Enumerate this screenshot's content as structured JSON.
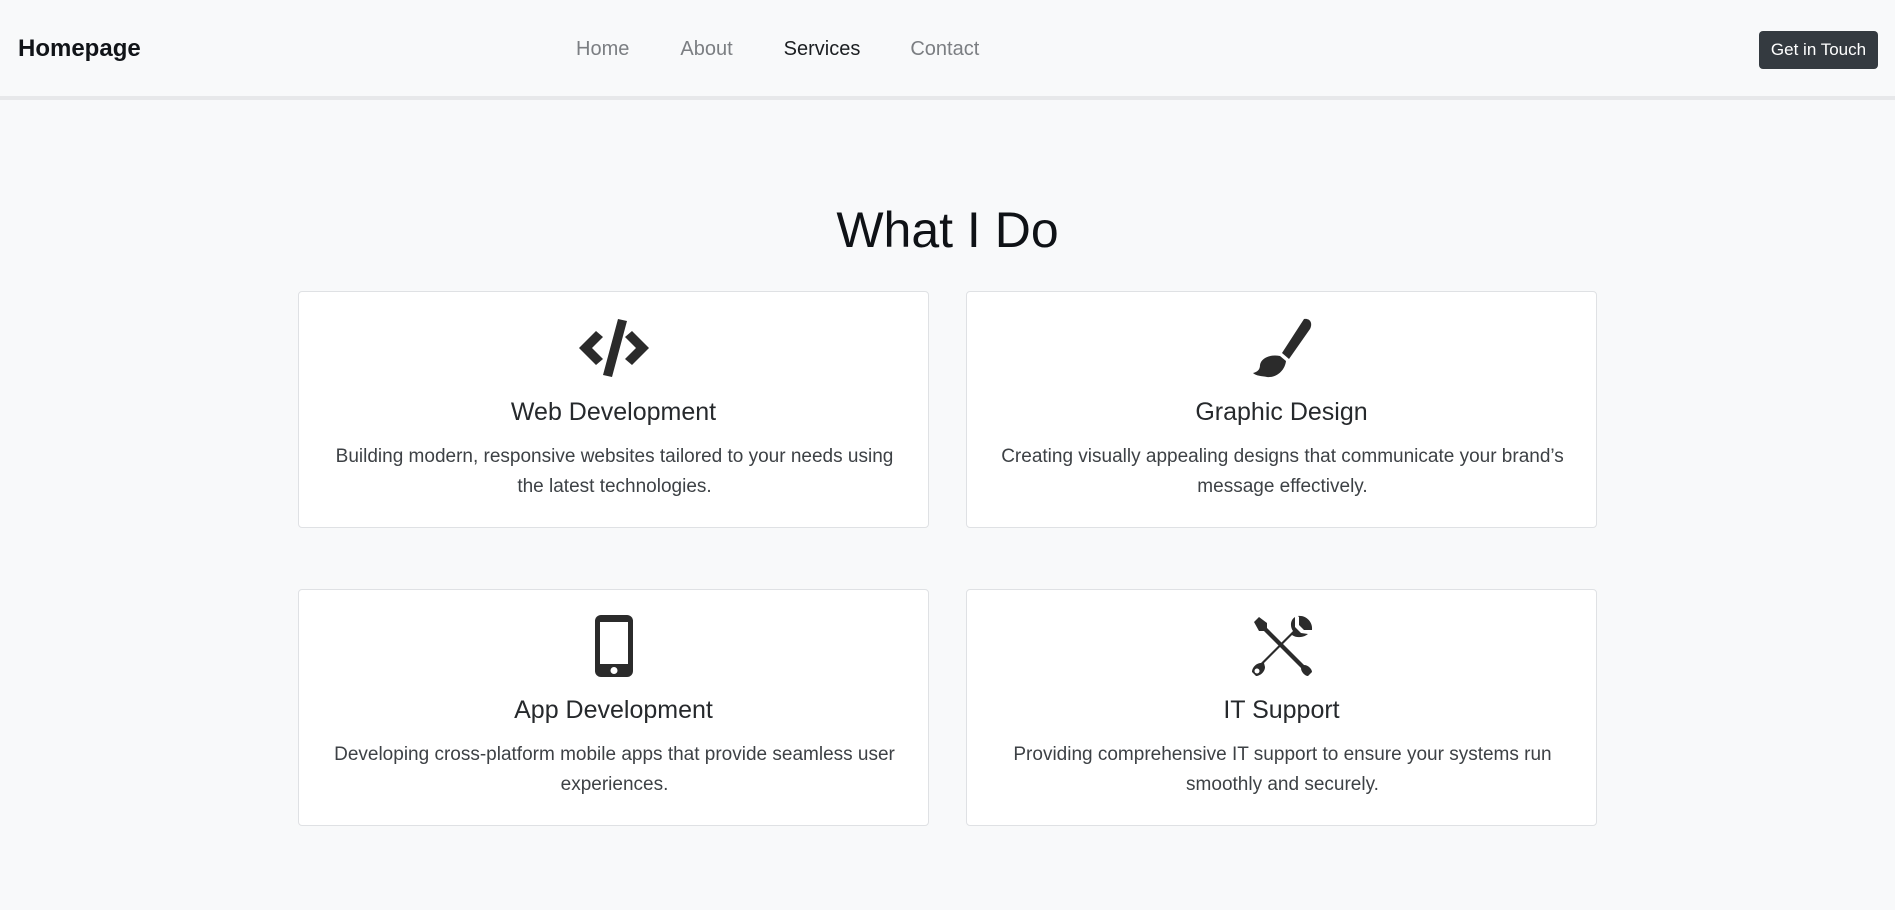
{
  "header": {
    "brand": "Homepage",
    "nav": [
      {
        "label": "Home",
        "active": false
      },
      {
        "label": "About",
        "active": false
      },
      {
        "label": "Services",
        "active": true
      },
      {
        "label": "Contact",
        "active": false
      }
    ],
    "cta_label": "Get in Touch"
  },
  "main": {
    "title": "What I Do",
    "services": [
      {
        "icon": "code-icon",
        "title": "Web Development",
        "description": "Building modern, responsive websites tailored to your needs using the latest technologies."
      },
      {
        "icon": "paintbrush-icon",
        "title": "Graphic Design",
        "description": "Creating visually appealing designs that communicate your brand’s message effectively."
      },
      {
        "icon": "mobile-phone-icon",
        "title": "App Development",
        "description": "Developing cross-platform mobile apps that provide seamless user experiences."
      },
      {
        "icon": "tools-icon",
        "title": "IT Support",
        "description": "Providing comprehensive IT support to ensure your systems run smoothly and securely."
      }
    ]
  },
  "colors": {
    "background": "#f8f9fa",
    "card_background": "#ffffff",
    "button_background": "#343a40",
    "icon_color": "#2b2b2b"
  }
}
